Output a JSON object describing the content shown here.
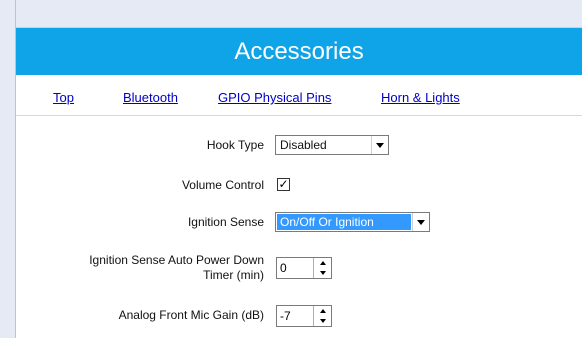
{
  "header": {
    "title": "Accessories"
  },
  "nav": {
    "links": [
      "Top",
      "Bluetooth",
      "GPIO Physical Pins",
      "Horn & Lights"
    ]
  },
  "form": {
    "hook_type": {
      "label": "Hook Type",
      "value": "Disabled"
    },
    "volume_control": {
      "label": "Volume Control",
      "checked": true,
      "check_glyph": "✓"
    },
    "ignition_sense": {
      "label": "Ignition Sense",
      "value": "On/Off Or Ignition"
    },
    "auto_power_down": {
      "label_line1": "Ignition Sense Auto Power Down",
      "label_line2": "Timer (min)",
      "value": "0"
    },
    "mic_gain": {
      "label": "Analog Front Mic Gain (dB)",
      "value": "-7"
    }
  },
  "colors": {
    "banner": "#0fa3e8",
    "link": "#0000c8",
    "selection": "#3399ff"
  }
}
